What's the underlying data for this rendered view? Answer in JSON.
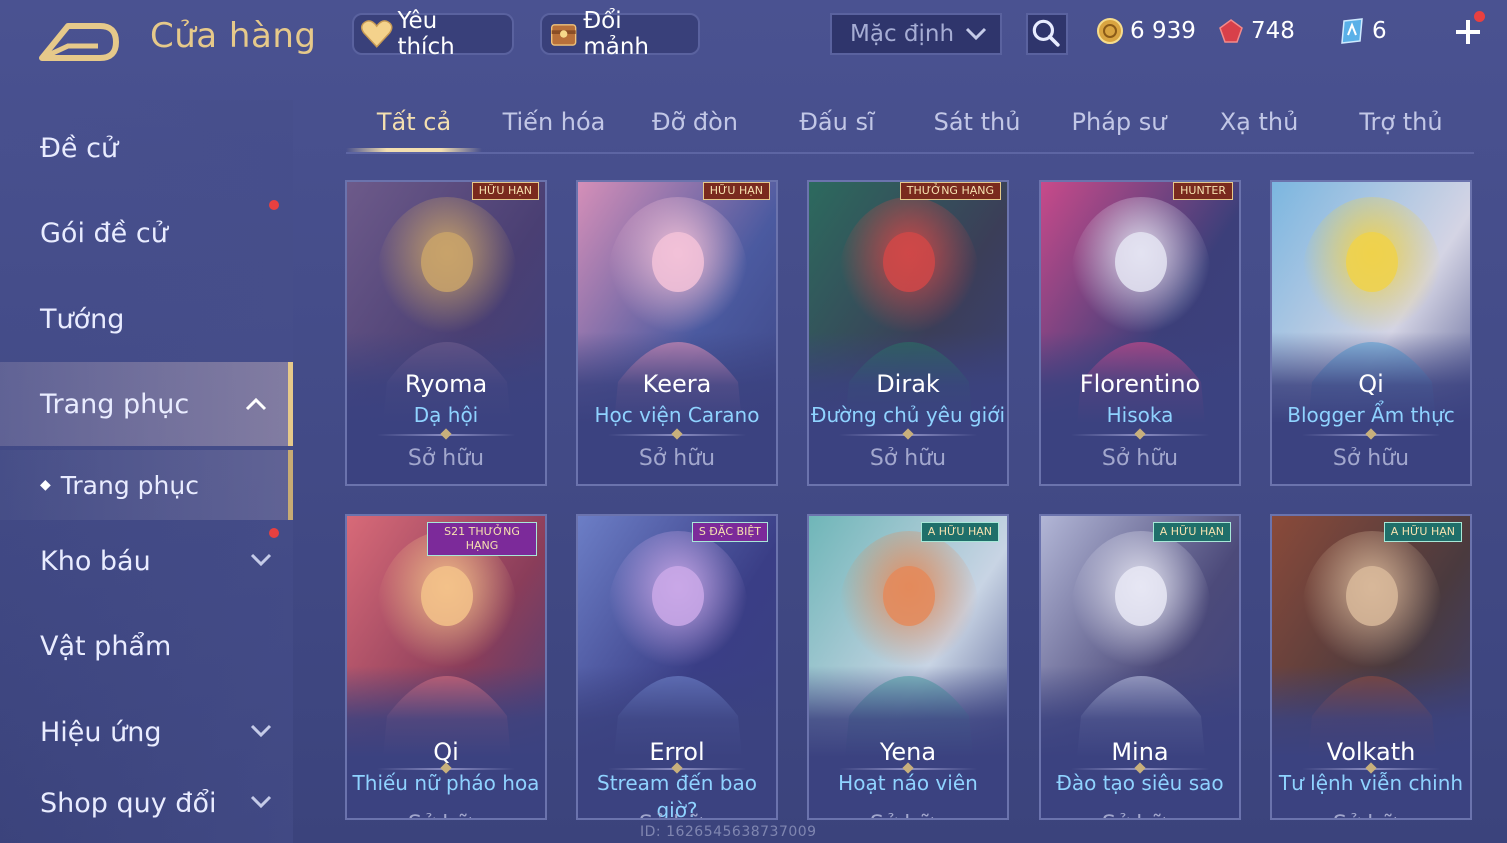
{
  "header": {
    "title": "Cửa hàng",
    "favorite_label": "Yêu thích",
    "exchange_label": "Đổi mảnh",
    "sort_selected": "Mặc định",
    "gold": "6 939",
    "ruby": "748",
    "tickets": "6"
  },
  "sidebar": {
    "items": [
      {
        "label": "Đề cử"
      },
      {
        "label": "Gói đề cử"
      },
      {
        "label": "Tướng"
      },
      {
        "label": "Trang phục"
      },
      {
        "label": "Trang phục"
      },
      {
        "label": "Kho báu"
      },
      {
        "label": "Vật phẩm"
      },
      {
        "label": "Hiệu ứng"
      },
      {
        "label": "Shop quy đổi"
      }
    ]
  },
  "tabs": [
    "Tất cả",
    "Tiến hóa",
    "Đỡ đòn",
    "Đấu sĩ",
    "Sát thủ",
    "Pháp sư",
    "Xạ thủ",
    "Trợ thủ"
  ],
  "cards": [
    {
      "hero": "Ryoma",
      "skin": "Dạ hội",
      "status": "Sở hữu",
      "badge": "HỮU HẠN",
      "palette": [
        "#6d5a8a",
        "#c9a36a",
        "#4a3f73"
      ]
    },
    {
      "hero": "Keera",
      "skin": "Học viện Carano",
      "status": "Sở hữu",
      "badge": "HỮU HẠN",
      "palette": [
        "#d58fb8",
        "#f3c2d8",
        "#4b5aa0"
      ]
    },
    {
      "hero": "Dirak",
      "skin": "Đường chủ yêu giới",
      "status": "Sở hữu",
      "badge": "THƯỞNG HẠNG",
      "palette": [
        "#2c6a5e",
        "#d04848",
        "#3b3e58"
      ]
    },
    {
      "hero": "Florentino",
      "skin": "Hisoka",
      "status": "Sở hữu",
      "badge": "HUNTER",
      "palette": [
        "#c84a8a",
        "#e4e4f2",
        "#3c3f7a"
      ]
    },
    {
      "hero": "Qi",
      "skin": "Blogger Ẩm thực",
      "status": "Sở hữu",
      "badge": "",
      "palette": [
        "#7bb6e0",
        "#f0d24a",
        "#d4d4e4"
      ]
    },
    {
      "hero": "Qi",
      "skin": "Thiếu nữ pháo hoa",
      "status": "Sở hữu",
      "badge": "S21 THƯỞNG HẠNG",
      "palette": [
        "#d86a78",
        "#f3c28a",
        "#8a3d5a"
      ]
    },
    {
      "hero": "Errol",
      "skin": "Stream đến bao giờ?",
      "status": "Sở hữu",
      "badge": "S ĐẶC BIỆT",
      "palette": [
        "#6c7ec6",
        "#caa8e8",
        "#3a3e86"
      ]
    },
    {
      "hero": "Yena",
      "skin": "Hoạt náo viên",
      "status": "Sở hữu",
      "badge": "A HỮU HẠN",
      "palette": [
        "#6fb6b8",
        "#e48a5a",
        "#c8d4e4"
      ]
    },
    {
      "hero": "Mina",
      "skin": "Đào tạo siêu sao",
      "status": "Sở hữu",
      "badge": "A HỮU HẠN",
      "palette": [
        "#b2b6d6",
        "#e8e8f4",
        "#4c4a7a"
      ]
    },
    {
      "hero": "Volkath",
      "skin": "Tư lệnh viễn chinh",
      "status": "Sở hữu",
      "badge": "A HỮU HẠN",
      "palette": [
        "#8a4a3a",
        "#d8b89a",
        "#4a3a3e"
      ]
    }
  ],
  "footer": {
    "uid": "ID: 1626545638737009"
  },
  "colors": {
    "accent_gold": "#e6c98a",
    "skin_name": "#8fd3ff",
    "notification": "#e84040"
  }
}
